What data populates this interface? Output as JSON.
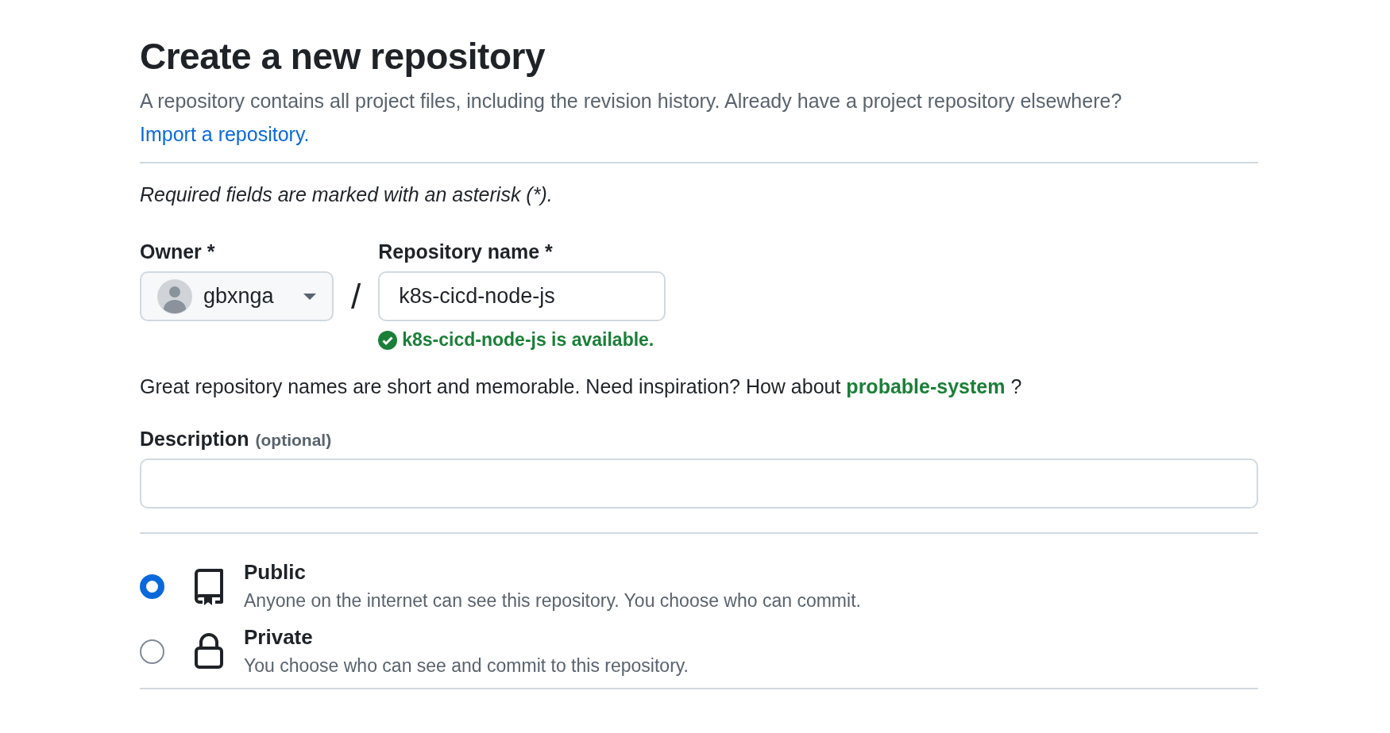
{
  "header": {
    "title": "Create a new repository",
    "intro": "A repository contains all project files, including the revision history. Already have a project repository elsewhere?",
    "import_link": "Import a repository."
  },
  "required_note": "Required fields are marked with an asterisk (*).",
  "owner": {
    "label": "Owner *",
    "value": "gbxnga"
  },
  "separator": "/",
  "repository_name": {
    "label": "Repository name *",
    "value": "k8s-cicd-node-js",
    "status": "k8s-cicd-node-js is available."
  },
  "suggestion": {
    "text": "Great repository names are short and memorable. Need inspiration? How about",
    "link": "probable-system",
    "after": "?"
  },
  "description": {
    "label": "Description",
    "hint": "(optional)"
  },
  "visibility": [
    {
      "kind": "public",
      "title": "Public",
      "text": "Anyone on the internet can see this repository. You choose who can commit.",
      "selected": true
    },
    {
      "kind": "private",
      "title": "Private",
      "text": "You choose who can see and commit to this repository.",
      "selected": false
    }
  ]
}
